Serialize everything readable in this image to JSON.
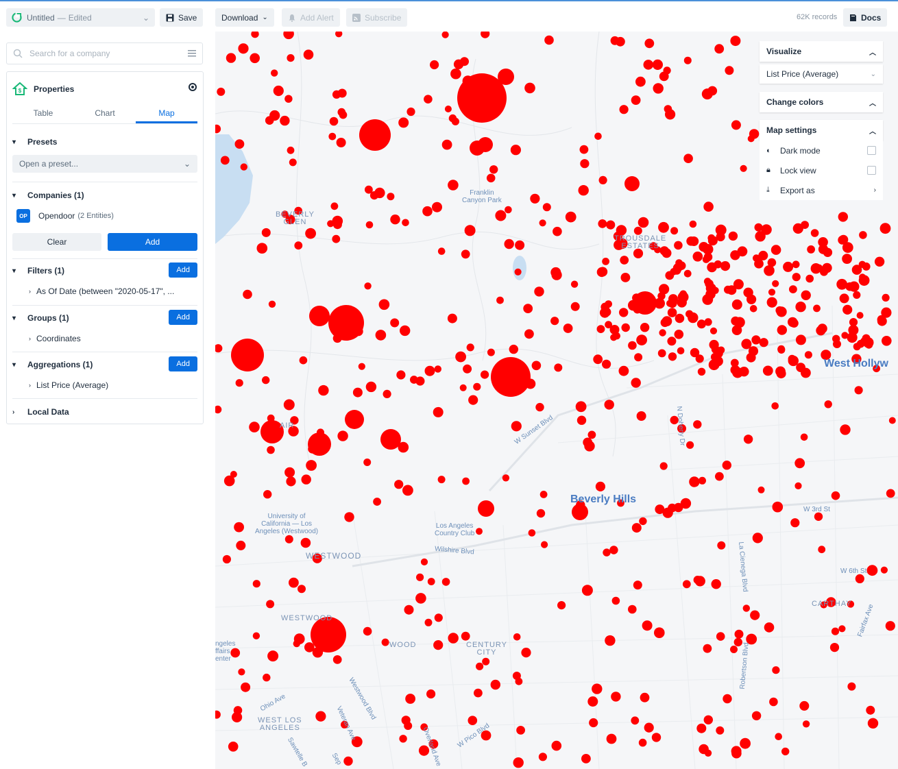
{
  "topbar": {
    "doc_title": "Untitled",
    "doc_status": "Edited",
    "save_label": "Save",
    "download_label": "Download",
    "add_alert_label": "Add Alert",
    "subscribe_label": "Subscribe",
    "records": "62K records",
    "docs_label": "Docs"
  },
  "sidebar": {
    "search_placeholder": "Search for a company",
    "panel_title": "Properties",
    "tabs": [
      "Table",
      "Chart",
      "Map"
    ],
    "active_tab": "Map",
    "presets": {
      "title": "Presets",
      "placeholder": "Open a preset..."
    },
    "companies": {
      "title": "Companies (1)",
      "badge": "OP",
      "name": "Opendoor",
      "detail": "(2 Entities)",
      "clear_label": "Clear",
      "add_label": "Add"
    },
    "filters": {
      "title": "Filters (1)",
      "add_label": "Add",
      "item": "As Of Date (between \"2020-05-17\", ..."
    },
    "groups": {
      "title": "Groups (1)",
      "add_label": "Add",
      "item": "Coordinates"
    },
    "aggregations": {
      "title": "Aggregations (1)",
      "add_label": "Add",
      "item": "List Price (Average)"
    },
    "local_data": {
      "title": "Local Data"
    }
  },
  "map_labels": {
    "franklin": "Franklin\nCanyon Park",
    "beverly_glen": "BEVERLY\nGLEN",
    "trousdale": "TROUSDALE\nESTATES",
    "west_hollywood": "West Hollyw",
    "beverly_hills": "Beverly Hills",
    "ucla": "University of\nCalifornia — Los\nAngeles (Westwood)",
    "lacc": "Los Angeles\nCountry Club",
    "westwood": "WESTWOOD",
    "westwood2": "WESTWOOD",
    "century_city": "CENTURY\nCITY",
    "carthay": "CARTHAY",
    "west_los_angeles": "WEST LOS\nANGELES",
    "sunset": "W Sunset Blvd",
    "wilshire": "Wilshire Blvd",
    "w3rd": "W 3rd St",
    "w6th": "W 6th St",
    "la_cienega": "La Cienega Blvd",
    "robertson": "Robertson Blvd",
    "fairfax": "Fairfax Ave",
    "pico": "W Pico Blvd",
    "ohio": "Ohio Ave",
    "westwood_blvd": "Westwood Blvd",
    "overland": "Overland Ave",
    "n_doheny": "N Doheny Dr",
    "bel_air": "AIR",
    "veteran": "Veteran Ave",
    "sawtelle": "Sawtelle B",
    "la_affairs": "ngeles\nffairs\nenter",
    "westwood3": "WOOD",
    "sep": "Sep"
  },
  "visualize": {
    "title": "Visualize",
    "metric": "List Price (Average)",
    "change_colors": "Change colors",
    "map_settings": "Map settings",
    "dark_mode": "Dark mode",
    "lock_view": "Lock view",
    "export_as": "Export as"
  },
  "colors": {
    "accent": "#0a6fe0",
    "point": "#ff0000",
    "map_bg": "#f5f6f8",
    "water": "#c8def2"
  }
}
